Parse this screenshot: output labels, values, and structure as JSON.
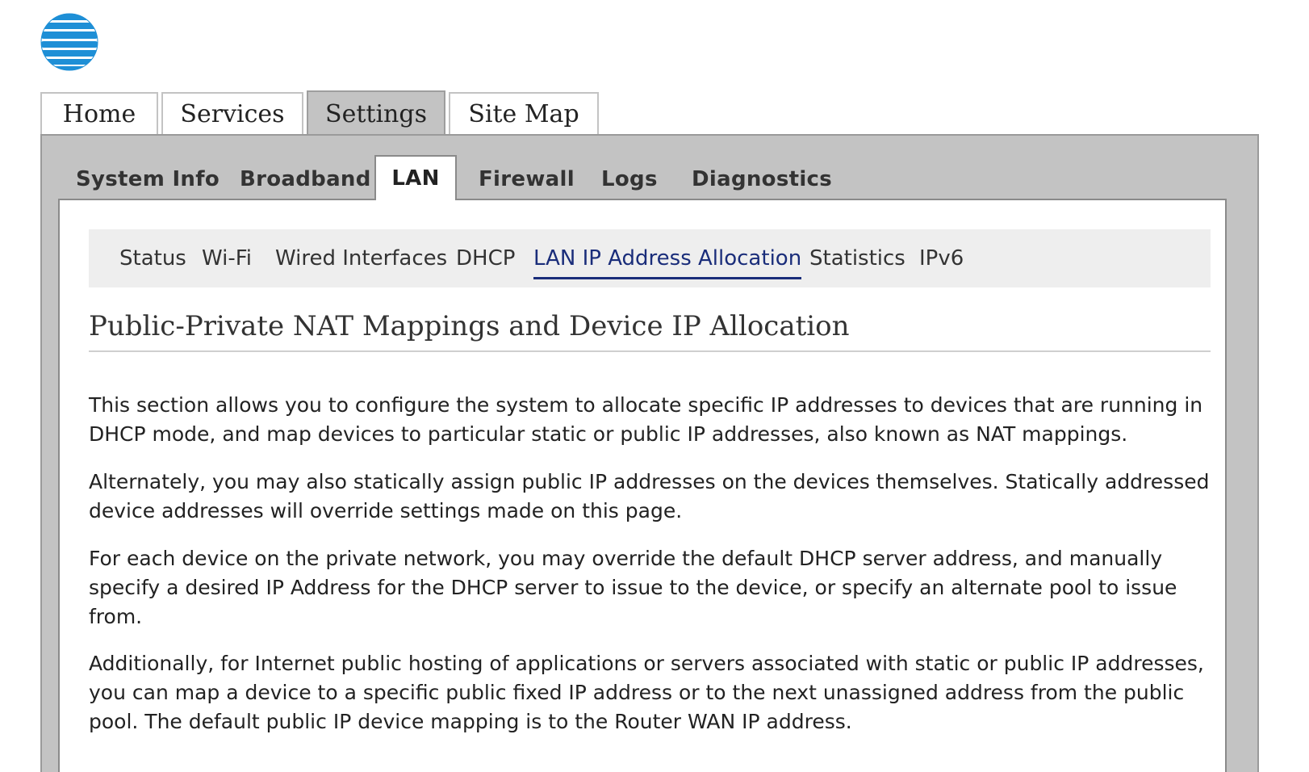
{
  "colors": {
    "brand_blue": "#1e8fd6",
    "active_nav": "#1a2d7a",
    "frame_gray": "#c3c3c3"
  },
  "logo": {
    "icon": "att-globe-icon"
  },
  "top_tabs": [
    "Home",
    "Services",
    "Settings",
    "Site Map"
  ],
  "top_tabs_active": "Settings",
  "sub_tabs": [
    "System Info",
    "Broadband",
    "LAN",
    "Firewall",
    "Logs",
    "Diagnostics"
  ],
  "sub_tabs_active": "LAN",
  "lan_nav": [
    "Status",
    "Wi-Fi",
    "Wired Interfaces",
    "DHCP",
    "LAN IP Address Allocation",
    "Statistics",
    "IPv6"
  ],
  "lan_nav_active": "LAN IP Address Allocation",
  "content": {
    "heading": "Public-Private NAT Mappings and Device IP Allocation",
    "paragraphs": [
      "This section allows you to configure the system to allocate specific IP addresses to devices that are running in DHCP mode, and map devices to particular static or public IP addresses, also known as NAT mappings.",
      "Alternately, you may also statically assign public IP addresses on the devices themselves. Statically addressed device addresses will override settings made on this page.",
      "For each device on the private network, you may override the default DHCP server address, and manually specify a desired IP Address for the DHCP server to issue to the device, or specify an alternate pool to issue from.",
      "Additionally, for Internet public hosting of applications or servers associated with static or public IP addresses, you can map a device to a specific public fixed IP address or to the next unassigned address from the public pool. The default public IP device mapping is to the Router WAN IP address."
    ]
  }
}
